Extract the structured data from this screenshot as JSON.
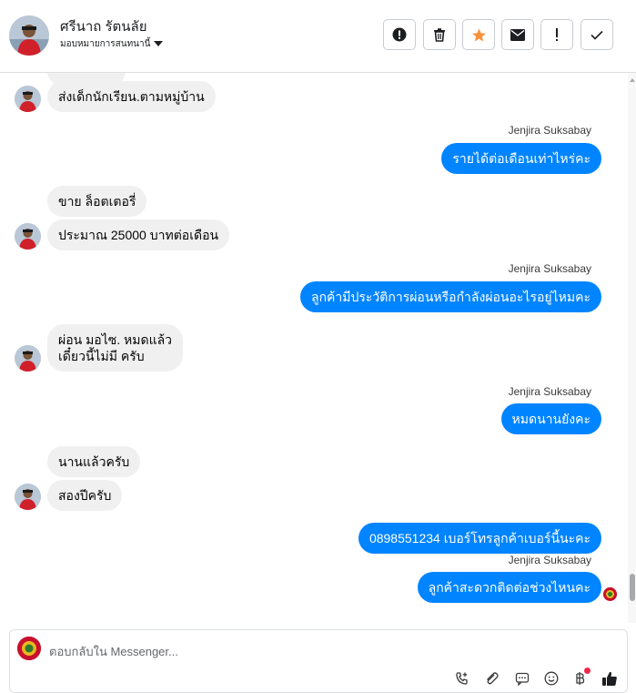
{
  "header": {
    "contact_name": "ศรีนาถ รัตนลัย",
    "assignee_label": "มอบหมายการสนทนานี้",
    "toolbar": {
      "alert_icon": "alert-circle-icon",
      "trash_icon": "trash-icon",
      "star_icon": "star-icon",
      "mail_icon": "envelope-icon",
      "exclamation_icon": "exclamation-icon",
      "check_icon": "check-icon"
    }
  },
  "colors": {
    "brand_blue": "#0084ff",
    "incoming_bg": "#f0f0f0",
    "star_orange": "#f7923a",
    "like_blue": "#0084ff",
    "badge_red": "#f02849"
  },
  "messages": [
    {
      "dir": "in",
      "text": "ส่งเด็กนักเรียน.ตามหมู่บ้าน"
    },
    {
      "dir": "out",
      "sender": "Jenjira Suksabay",
      "text": "รายได้ต่อเดือนเท่าไหร่คะ"
    },
    {
      "dir": "in",
      "text": "ขาย ล็อตเตอรี่"
    },
    {
      "dir": "in",
      "text": "ประมาณ 25000 บาทต่อเดือน"
    },
    {
      "dir": "out",
      "sender": "Jenjira Suksabay",
      "text": "ลูกค้ามีประวัติการผ่อนหรือกำลังผ่อนอะไรอยู่ไหมคะ"
    },
    {
      "dir": "in",
      "text": "ผ่อน มอไซ. หมดแล้ว",
      "text2": "เดี๋ยวนี้ไม่มี ครับ"
    },
    {
      "dir": "out",
      "sender": "Jenjira Suksabay",
      "text": "หมดนานยังคะ"
    },
    {
      "dir": "in",
      "text": "นานแล้วครับ"
    },
    {
      "dir": "in",
      "text": "สองปีครับ"
    },
    {
      "dir": "out",
      "text": "0898551234 เบอร์โทรลูกค้าเบอร์นี้นะคะ"
    },
    {
      "dir": "out",
      "sender": "Jenjira Suksabay",
      "text": "ลูกค้าสะดวกติดต่อช่วงไหนคะ"
    }
  ],
  "composer": {
    "placeholder": "ตอบกลับใน Messenger...",
    "icons": [
      "phone-add-icon",
      "paperclip-icon",
      "message-template-icon",
      "emoji-icon",
      "baht-icon",
      "thumbs-up-icon"
    ]
  }
}
